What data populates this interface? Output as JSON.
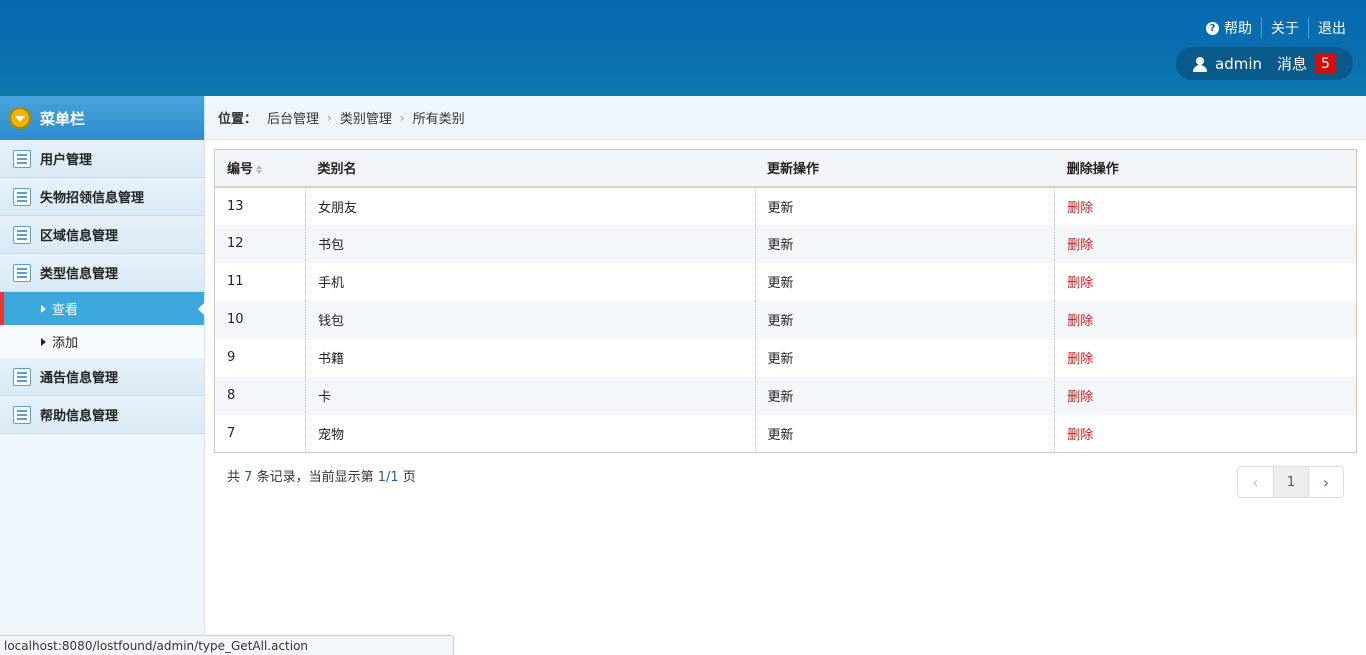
{
  "header": {
    "help_label": "帮助",
    "about_label": "关于",
    "logout_label": "退出",
    "username": "admin",
    "message_label": "消息",
    "message_count": "5"
  },
  "sidebar": {
    "title": "菜单栏",
    "items": [
      {
        "label": "用户管理"
      },
      {
        "label": "失物招领信息管理"
      },
      {
        "label": "区域信息管理"
      },
      {
        "label": "类型信息管理"
      }
    ],
    "sub_items": [
      {
        "label": "查看",
        "active": true
      },
      {
        "label": "添加",
        "active": false
      }
    ],
    "items_after": [
      {
        "label": "通告信息管理"
      },
      {
        "label": "帮助信息管理"
      }
    ]
  },
  "breadcrumb": {
    "position_label": "位置：",
    "items": [
      "后台管理",
      "类别管理",
      "所有类别"
    ]
  },
  "table": {
    "headers": [
      "编号",
      "类别名",
      "更新操作",
      "删除操作"
    ],
    "rows": [
      {
        "id": "13",
        "name": "女朋友",
        "update": "更新",
        "delete": "删除"
      },
      {
        "id": "12",
        "name": "书包",
        "update": "更新",
        "delete": "删除"
      },
      {
        "id": "11",
        "name": "手机",
        "update": "更新",
        "delete": "删除"
      },
      {
        "id": "10",
        "name": "钱包",
        "update": "更新",
        "delete": "删除"
      },
      {
        "id": "9",
        "name": "书籍",
        "update": "更新",
        "delete": "删除"
      },
      {
        "id": "8",
        "name": "卡",
        "update": "更新",
        "delete": "删除"
      },
      {
        "id": "7",
        "name": "宠物",
        "update": "更新",
        "delete": "删除"
      }
    ]
  },
  "footer": {
    "records_prefix": "共",
    "records_total": "7",
    "records_middle": "条记录，当前显示第",
    "records_page": "1/1",
    "records_suffix": "页"
  },
  "pager": {
    "prev": "‹",
    "current": "1",
    "next": "›"
  },
  "statusbar": {
    "url": "localhost:8080/lostfound/admin/type_GetAll.action"
  },
  "colors": {
    "header_blue": "#0769b2",
    "active_blue": "#3da8de",
    "delete_red": "#cc1a1a",
    "badge_red": "#d40d0d"
  }
}
